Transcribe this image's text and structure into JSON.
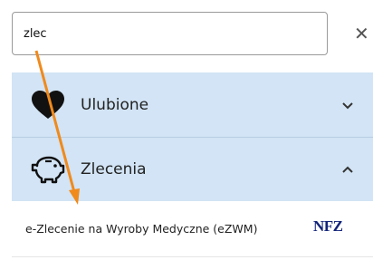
{
  "search": {
    "value": "zlec",
    "placeholder": ""
  },
  "clear": {
    "glyph": "✕"
  },
  "sections": [
    {
      "label": "Ulubione",
      "icon": "heart-icon",
      "chevron": "chevron-down-icon"
    },
    {
      "label": "Zlecenia",
      "icon": "piggy-bank-icon",
      "chevron": "chevron-up-icon"
    }
  ],
  "results": [
    {
      "label": "e-Zlecenie na Wyroby Medyczne (eZWM)",
      "logo": "NFZ"
    }
  ],
  "colors": {
    "section_bg": "#d2e4f5",
    "annotation_arrow": "#f08a1c",
    "nfz_logo": "#12237a"
  }
}
